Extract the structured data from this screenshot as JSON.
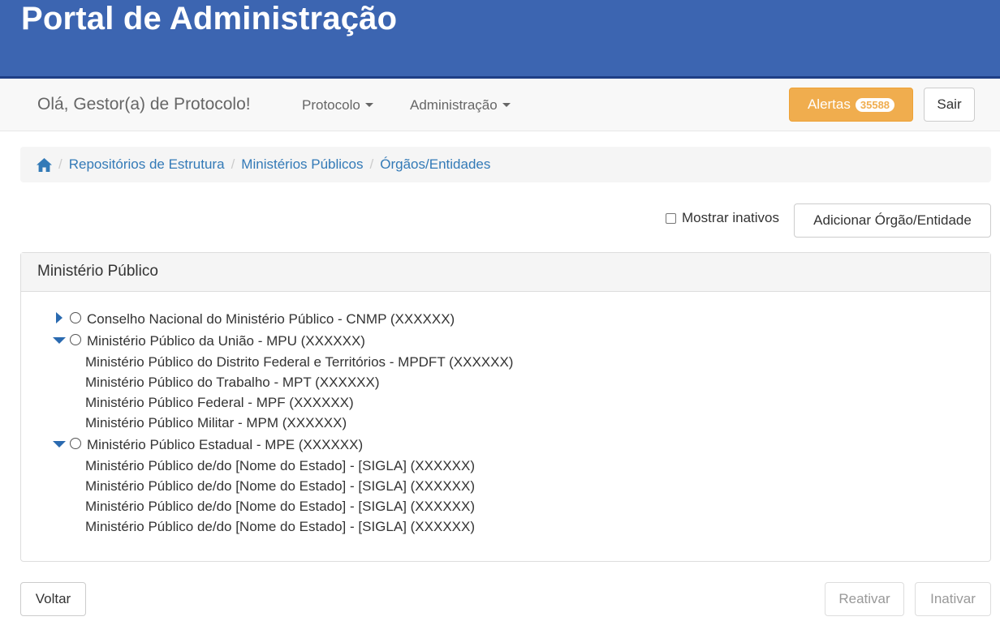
{
  "header": {
    "title": "Portal de Administração"
  },
  "navbar": {
    "greeting": "Olá, Gestor(a) de Protocolo!",
    "menus": [
      {
        "label": "Protocolo"
      },
      {
        "label": "Administração"
      }
    ],
    "alerts_label": "Alertas",
    "alerts_count": "35588",
    "logout_label": "Sair"
  },
  "breadcrumb": {
    "home_icon": "home-icon",
    "items": [
      "Repositórios de Estrutura",
      "Ministérios Públicos",
      "Órgãos/Entidades"
    ]
  },
  "toolbar": {
    "show_inactive_label": "Mostrar inativos",
    "show_inactive_checked": false,
    "add_label": "Adicionar Órgão/Entidade"
  },
  "panel": {
    "title": "Ministério Público",
    "tree": [
      {
        "label": "Conselho Nacional do Ministério Público - CNMP (XXXXXX)",
        "expanded": false,
        "children": []
      },
      {
        "label": "Ministério Público da União - MPU (XXXXXX)",
        "expanded": true,
        "children": [
          "Ministério Público do Distrito Federal e Territórios - MPDFT (XXXXXX)",
          "Ministério Público do Trabalho - MPT (XXXXXX)",
          "Ministério Público Federal - MPF (XXXXXX)",
          "Ministério Público Militar - MPM (XXXXXX)"
        ]
      },
      {
        "label": "Ministério Público Estadual - MPE (XXXXXX)",
        "expanded": true,
        "children": [
          "Ministério Público de/do [Nome do Estado] - [SIGLA] (XXXXXX)",
          "Ministério Público de/do [Nome do Estado] - [SIGLA] (XXXXXX)",
          "Ministério Público de/do [Nome do Estado] - [SIGLA] (XXXXXX)",
          "Ministério Público de/do [Nome do Estado] - [SIGLA] (XXXXXX)"
        ]
      }
    ]
  },
  "footer": {
    "back_label": "Voltar",
    "reactivate_label": "Reativar",
    "deactivate_label": "Inativar"
  },
  "colors": {
    "header_bg": "#3c65b1",
    "alert_bg": "#f0ad4e",
    "link": "#337ab7",
    "tree_toggle": "#2a6ab0"
  }
}
